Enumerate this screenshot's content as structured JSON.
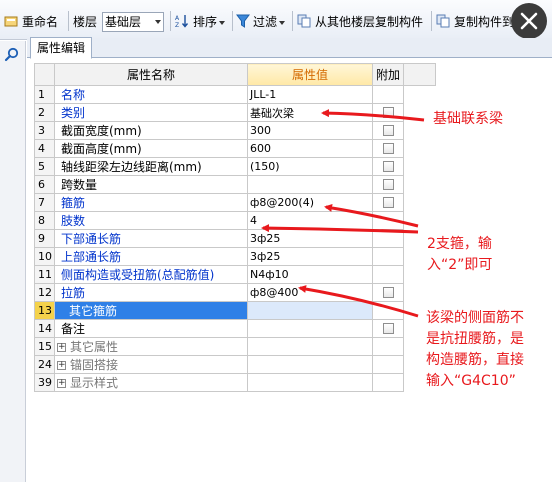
{
  "toolbar": {
    "rename_label": "重命名",
    "floor_label": "楼层",
    "floor_value": "基础层",
    "sort_label": "排序",
    "filter_label": "过滤",
    "copy_from_floor_label": "从其他楼层复制构件",
    "copy_to_label": "复制构件到"
  },
  "panel": {
    "tab_label": "属性编辑",
    "columns": {
      "name": "属性名称",
      "value": "属性值",
      "extra": "附加"
    }
  },
  "rows": [
    {
      "num": "1",
      "name": "名称",
      "value": "JLL-1",
      "style": "blue",
      "checkbox": false
    },
    {
      "num": "2",
      "name": "类别",
      "value": "基础次梁",
      "style": "blue",
      "checkbox": true
    },
    {
      "num": "3",
      "name": "截面宽度(mm)",
      "value": "300",
      "style": "black",
      "checkbox": true
    },
    {
      "num": "4",
      "name": "截面高度(mm)",
      "value": "600",
      "style": "black",
      "checkbox": true
    },
    {
      "num": "5",
      "name": "轴线距梁左边线距离(mm)",
      "value": "(150)",
      "style": "black",
      "checkbox": true
    },
    {
      "num": "6",
      "name": "跨数量",
      "value": "",
      "style": "black",
      "checkbox": true
    },
    {
      "num": "7",
      "name": "箍筋",
      "value": "ф8@200(4)",
      "style": "blue",
      "checkbox": true
    },
    {
      "num": "8",
      "name": "肢数",
      "value": "4",
      "style": "blue",
      "checkbox": false
    },
    {
      "num": "9",
      "name": "下部通长筋",
      "value": "3ф25",
      "style": "blue",
      "checkbox": false
    },
    {
      "num": "10",
      "name": "上部通长筋",
      "value": "3ф25",
      "style": "blue",
      "checkbox": false
    },
    {
      "num": "11",
      "name": "侧面构造或受扭筋(总配筋值)",
      "value": "N4ф10",
      "style": "blue",
      "checkbox": false
    },
    {
      "num": "12",
      "name": "拉筋",
      "value": "ф8@400",
      "style": "blue",
      "checkbox": true
    },
    {
      "num": "13",
      "name": "其它箍筋",
      "value": "",
      "style": "selected",
      "checkbox": false
    },
    {
      "num": "14",
      "name": "备注",
      "value": "",
      "style": "black",
      "checkbox": true
    },
    {
      "num": "15",
      "name": "其它属性",
      "value": "",
      "style": "group",
      "checkbox": false
    },
    {
      "num": "24",
      "name": "锚固搭接",
      "value": "",
      "style": "group",
      "checkbox": false
    },
    {
      "num": "39",
      "name": "显示样式",
      "value": "",
      "style": "group",
      "checkbox": false
    }
  ],
  "annotations": {
    "a1": "基础联系梁",
    "a2_line1": "2支箍，输",
    "a2_line2": "入“2”即可",
    "a3_line1": "该梁的侧面筋不",
    "a3_line2": "是抗扭腰筋，是",
    "a3_line3": "构造腰筋，直接",
    "a3_line4": "输入“G4C10”"
  },
  "colors": {
    "annotation": "#e8191d",
    "selected_row": "#2f80e7",
    "link_text": "#0033cc"
  }
}
